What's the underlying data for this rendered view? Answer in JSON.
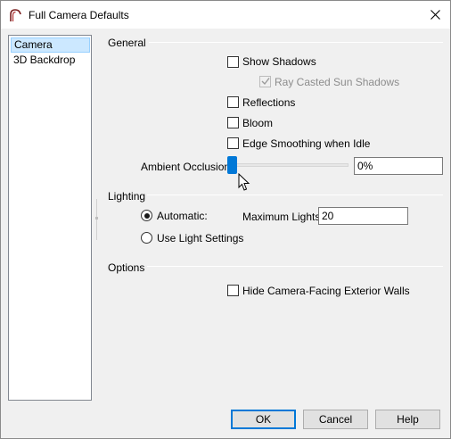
{
  "window": {
    "title": "Full Camera Defaults"
  },
  "nav": {
    "items": [
      {
        "label": "Camera",
        "selected": true
      },
      {
        "label": "3D Backdrop",
        "selected": false
      }
    ]
  },
  "general": {
    "heading": "General",
    "show_shadows": {
      "label": "Show Shadows",
      "checked": false
    },
    "ray_casted": {
      "label": "Ray Casted Sun Shadows",
      "checked": true,
      "disabled": true
    },
    "reflections": {
      "label": "Reflections",
      "checked": false
    },
    "bloom": {
      "label": "Bloom",
      "checked": false
    },
    "edge_smoothing": {
      "label": "Edge Smoothing when Idle",
      "checked": false
    },
    "ambient_occlusion": {
      "label": "Ambient Occlusion:",
      "value": "0%",
      "slider_fraction": 0
    }
  },
  "lighting": {
    "heading": "Lighting",
    "automatic": {
      "label": "Automatic:",
      "selected": true
    },
    "use_light_settings": {
      "label": "Use Light Settings",
      "selected": false
    },
    "max_lights": {
      "label": "Maximum Lights:",
      "value": "20"
    }
  },
  "options": {
    "heading": "Options",
    "hide_walls": {
      "label": "Hide Camera-Facing Exterior Walls",
      "checked": false
    }
  },
  "buttons": {
    "ok": "OK",
    "cancel": "Cancel",
    "help": "Help"
  },
  "colors": {
    "accent": "#0078d7",
    "selection_bg": "#cce8ff",
    "dialog_bg": "#f0f0f0"
  }
}
